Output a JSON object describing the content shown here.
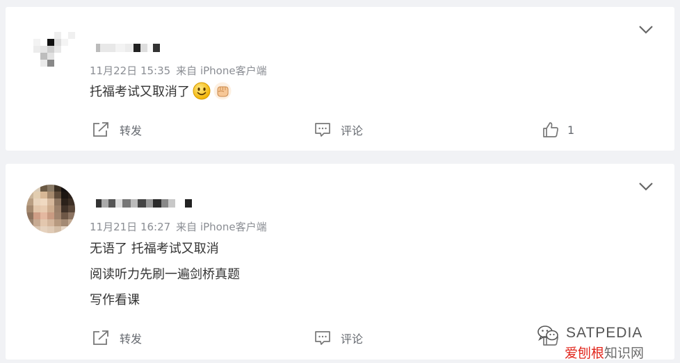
{
  "feed": {
    "comments": [
      {
        "time": "11月22日 15:35",
        "source": "来自 iPhone客户端",
        "lines": [
          "托福考试又取消了"
        ],
        "emojis": [
          "smile-emoji",
          "fist-emoji"
        ],
        "actions": {
          "repost": "转发",
          "comment": "评论",
          "like_count": "1"
        }
      },
      {
        "time": "11月21日 16:27",
        "source": "来自 iPhone客户端",
        "lines": [
          "无语了 托福考试又取消",
          "阅读听力先刷一遍剑桥真题",
          "写作看课"
        ],
        "actions": {
          "repost": "转发",
          "comment": "评论"
        }
      }
    ]
  },
  "watermark": {
    "brand": "SATPEDIA",
    "site": "爱刨根",
    "suffix": "知识网"
  },
  "colors": {
    "page_bg": "#f1f2f5",
    "card_bg": "#ffffff",
    "meta_text": "#8a8d93",
    "body_text": "#333333",
    "action_text": "#666a70",
    "watermark_red": "#e1251b"
  }
}
